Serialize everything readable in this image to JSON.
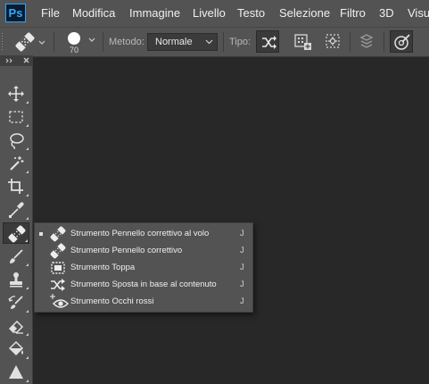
{
  "app": {
    "logo": "Ps"
  },
  "menu": [
    "File",
    "Modifica",
    "Immagine",
    "Livello",
    "Testo",
    "Selezione",
    "Filtro",
    "3D",
    "Visua"
  ],
  "options": {
    "brush_size": "70",
    "method_label": "Metodo:",
    "method_value": "Normale",
    "type_label": "Tipo:"
  },
  "toolbar": {
    "tools": [
      "move-icon",
      "marquee-icon",
      "lasso-icon",
      "magic-wand-icon",
      "crop-icon",
      "eyedropper-icon",
      "healing-brush-icon",
      "brush-icon",
      "clone-stamp-icon",
      "history-brush-icon",
      "eraser-icon",
      "paint-bucket-icon",
      "triangle-icon"
    ],
    "active_tool": "healing-brush-icon"
  },
  "flyout": {
    "items": [
      {
        "label": "Strumento Pennello correttivo al volo",
        "key": "J",
        "selected": true,
        "icon": "spot-healing-icon"
      },
      {
        "label": "Strumento Pennello correttivo",
        "key": "J",
        "selected": false,
        "icon": "healing-brush-icon"
      },
      {
        "label": "Strumento Toppa",
        "key": "J",
        "selected": false,
        "icon": "patch-icon"
      },
      {
        "label": "Strumento Sposta in base al contenuto",
        "key": "J",
        "selected": false,
        "icon": "content-aware-move-icon"
      },
      {
        "label": "Strumento Occhi rossi",
        "key": "J",
        "selected": false,
        "icon": "red-eye-icon"
      }
    ]
  },
  "colors": {
    "ui_bg": "#535353",
    "canvas_bg": "#282828",
    "accent": "#31a8ff"
  }
}
